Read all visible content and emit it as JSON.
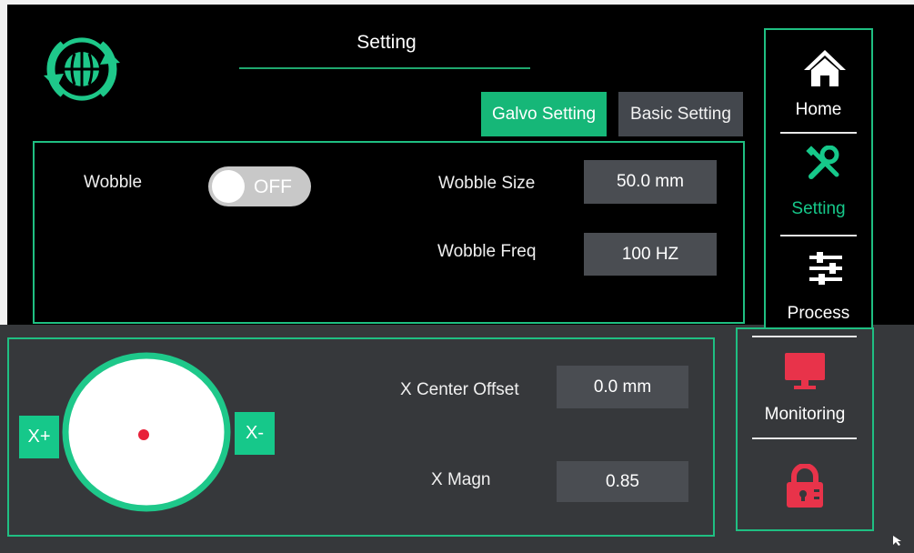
{
  "header": {
    "title": "Setting"
  },
  "tabs": [
    {
      "label": "Galvo Setting",
      "active": true
    },
    {
      "label": "Basic Setting",
      "active": false
    }
  ],
  "wobble": {
    "label": "Wobble",
    "toggle_state": "OFF",
    "size_label": "Wobble Size",
    "size_value": "50.0 mm",
    "freq_label": "Wobble Freq",
    "freq_value": "100 HZ"
  },
  "center": {
    "x_plus": "X+",
    "x_minus": "X-",
    "offset_label": "X Center Offset",
    "offset_value": "0.0 mm",
    "magn_label": "X Magn",
    "magn_value": "0.85"
  },
  "nav": [
    {
      "label": "Home",
      "icon": "home-icon",
      "active": false
    },
    {
      "label": "Setting",
      "icon": "wrench-screwdriver-icon",
      "active": true
    },
    {
      "label": "Process",
      "icon": "sliders-icon",
      "active": false
    },
    {
      "label": "Monitoring",
      "icon": "monitor-icon",
      "active": false
    },
    {
      "label": "",
      "icon": "lock-icon",
      "active": false
    }
  ],
  "colors": {
    "accent": "#16b778",
    "panel_border": "#1fbf82",
    "inactive_tab": "#43474d",
    "value_box": "#4a4d52",
    "warning": "#e8334a",
    "dot": "#e8213a"
  }
}
